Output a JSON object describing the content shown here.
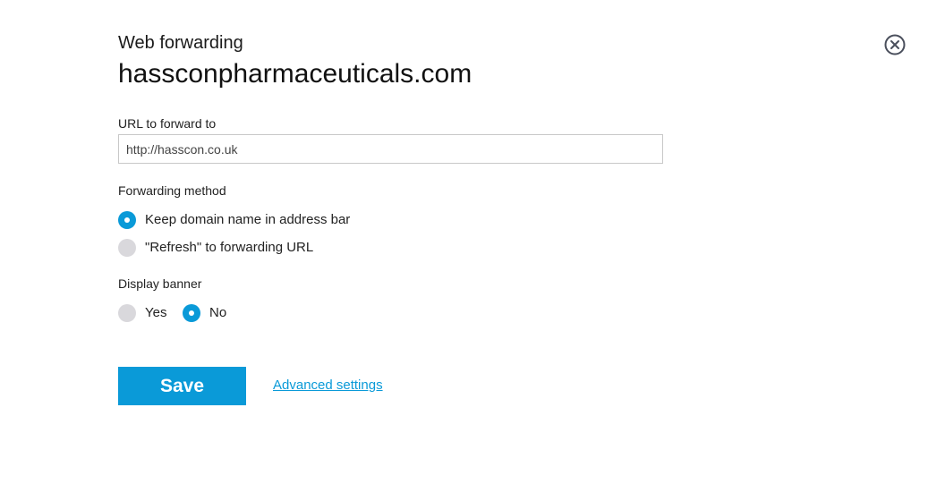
{
  "dialog": {
    "subtitle": "Web forwarding",
    "title": "hassconpharmaceuticals.com",
    "close_icon": "close-circle-icon"
  },
  "url_field": {
    "label": "URL to forward to",
    "value": "http://hasscon.co.uk"
  },
  "forwarding_method": {
    "label": "Forwarding method",
    "options": [
      {
        "label": "Keep domain name in address bar",
        "selected": true
      },
      {
        "label": "\"Refresh\" to forwarding URL",
        "selected": false
      }
    ]
  },
  "display_banner": {
    "label": "Display banner",
    "options": [
      {
        "label": "Yes",
        "selected": false
      },
      {
        "label": "No",
        "selected": true
      }
    ]
  },
  "actions": {
    "save_label": "Save",
    "advanced_label": "Advanced settings"
  },
  "colors": {
    "accent": "#0a9ad8",
    "radio_off": "#d9d8dc",
    "close_icon": "#4a4f5c"
  }
}
